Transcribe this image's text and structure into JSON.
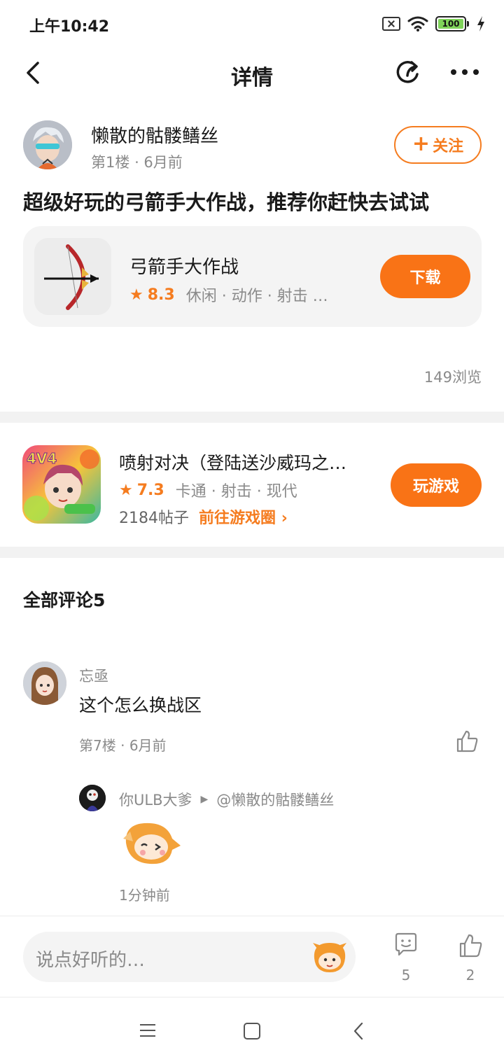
{
  "status_bar": {
    "time": "上午10:42",
    "battery": "100",
    "icons": [
      "sim-off-icon",
      "wifi-icon",
      "battery-icon",
      "charging-icon"
    ]
  },
  "nav": {
    "title": "详情",
    "icons": [
      "back-icon",
      "share-icon",
      "more-icon"
    ]
  },
  "post": {
    "author": "懒散的骷髅鳝丝",
    "floor": "第1楼",
    "time": "6月前",
    "follow_label": "关注",
    "title": "超级好玩的弓箭手大作战，推荐你赶快去试试",
    "views": "149浏览"
  },
  "game_card": {
    "name": "弓箭手大作战",
    "rating": "8.3",
    "tags": "休闲 · 动作 · 射击 …",
    "button": "下载"
  },
  "promo": {
    "name": "喷射对决（登陆送沙威玛之…",
    "rating": "7.3",
    "tags": "卡通 · 射击 · 现代",
    "posts": "2184帖子",
    "link": "前往游戏圈",
    "button": "玩游戏",
    "icon_badge": "4V4"
  },
  "comments": {
    "heading": "全部评论5",
    "items": [
      {
        "user": "忘亟",
        "text": "这个怎么换战区",
        "floor": "第7楼",
        "time": "6月前",
        "reply": {
          "user": "你ULB大爹",
          "mention": "@懒散的骷髅鳝丝",
          "time": "1分钟前"
        }
      }
    ]
  },
  "comment_bar": {
    "placeholder": "说点好听的…",
    "comment_count": "5",
    "like_count": "2"
  },
  "colors": {
    "accent": "#f97316",
    "text": "#1a1a1a",
    "muted": "#8a8a8a",
    "card_bg": "#f4f4f4"
  }
}
